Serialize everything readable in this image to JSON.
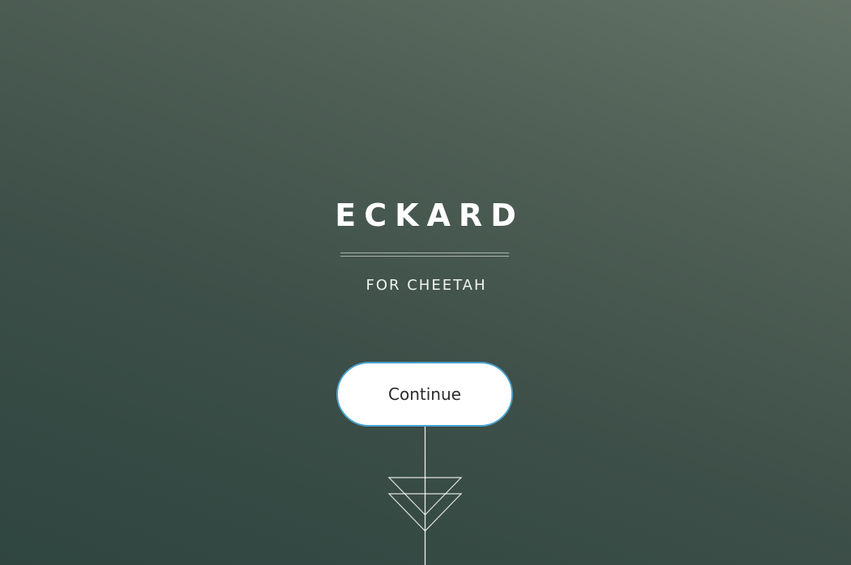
{
  "app": {
    "title": "ECKARD",
    "subtitle": "FOR CHEETAH"
  },
  "actions": {
    "continue_label": "Continue"
  },
  "colors": {
    "background_top": "#647366",
    "background_bottom": "#2f4540",
    "button_fill": "#ffffff",
    "button_border": "#4aa3cf",
    "emblem_stroke": "#ffffff"
  },
  "icons": {
    "emblem": "double-triangle-emblem-icon"
  }
}
